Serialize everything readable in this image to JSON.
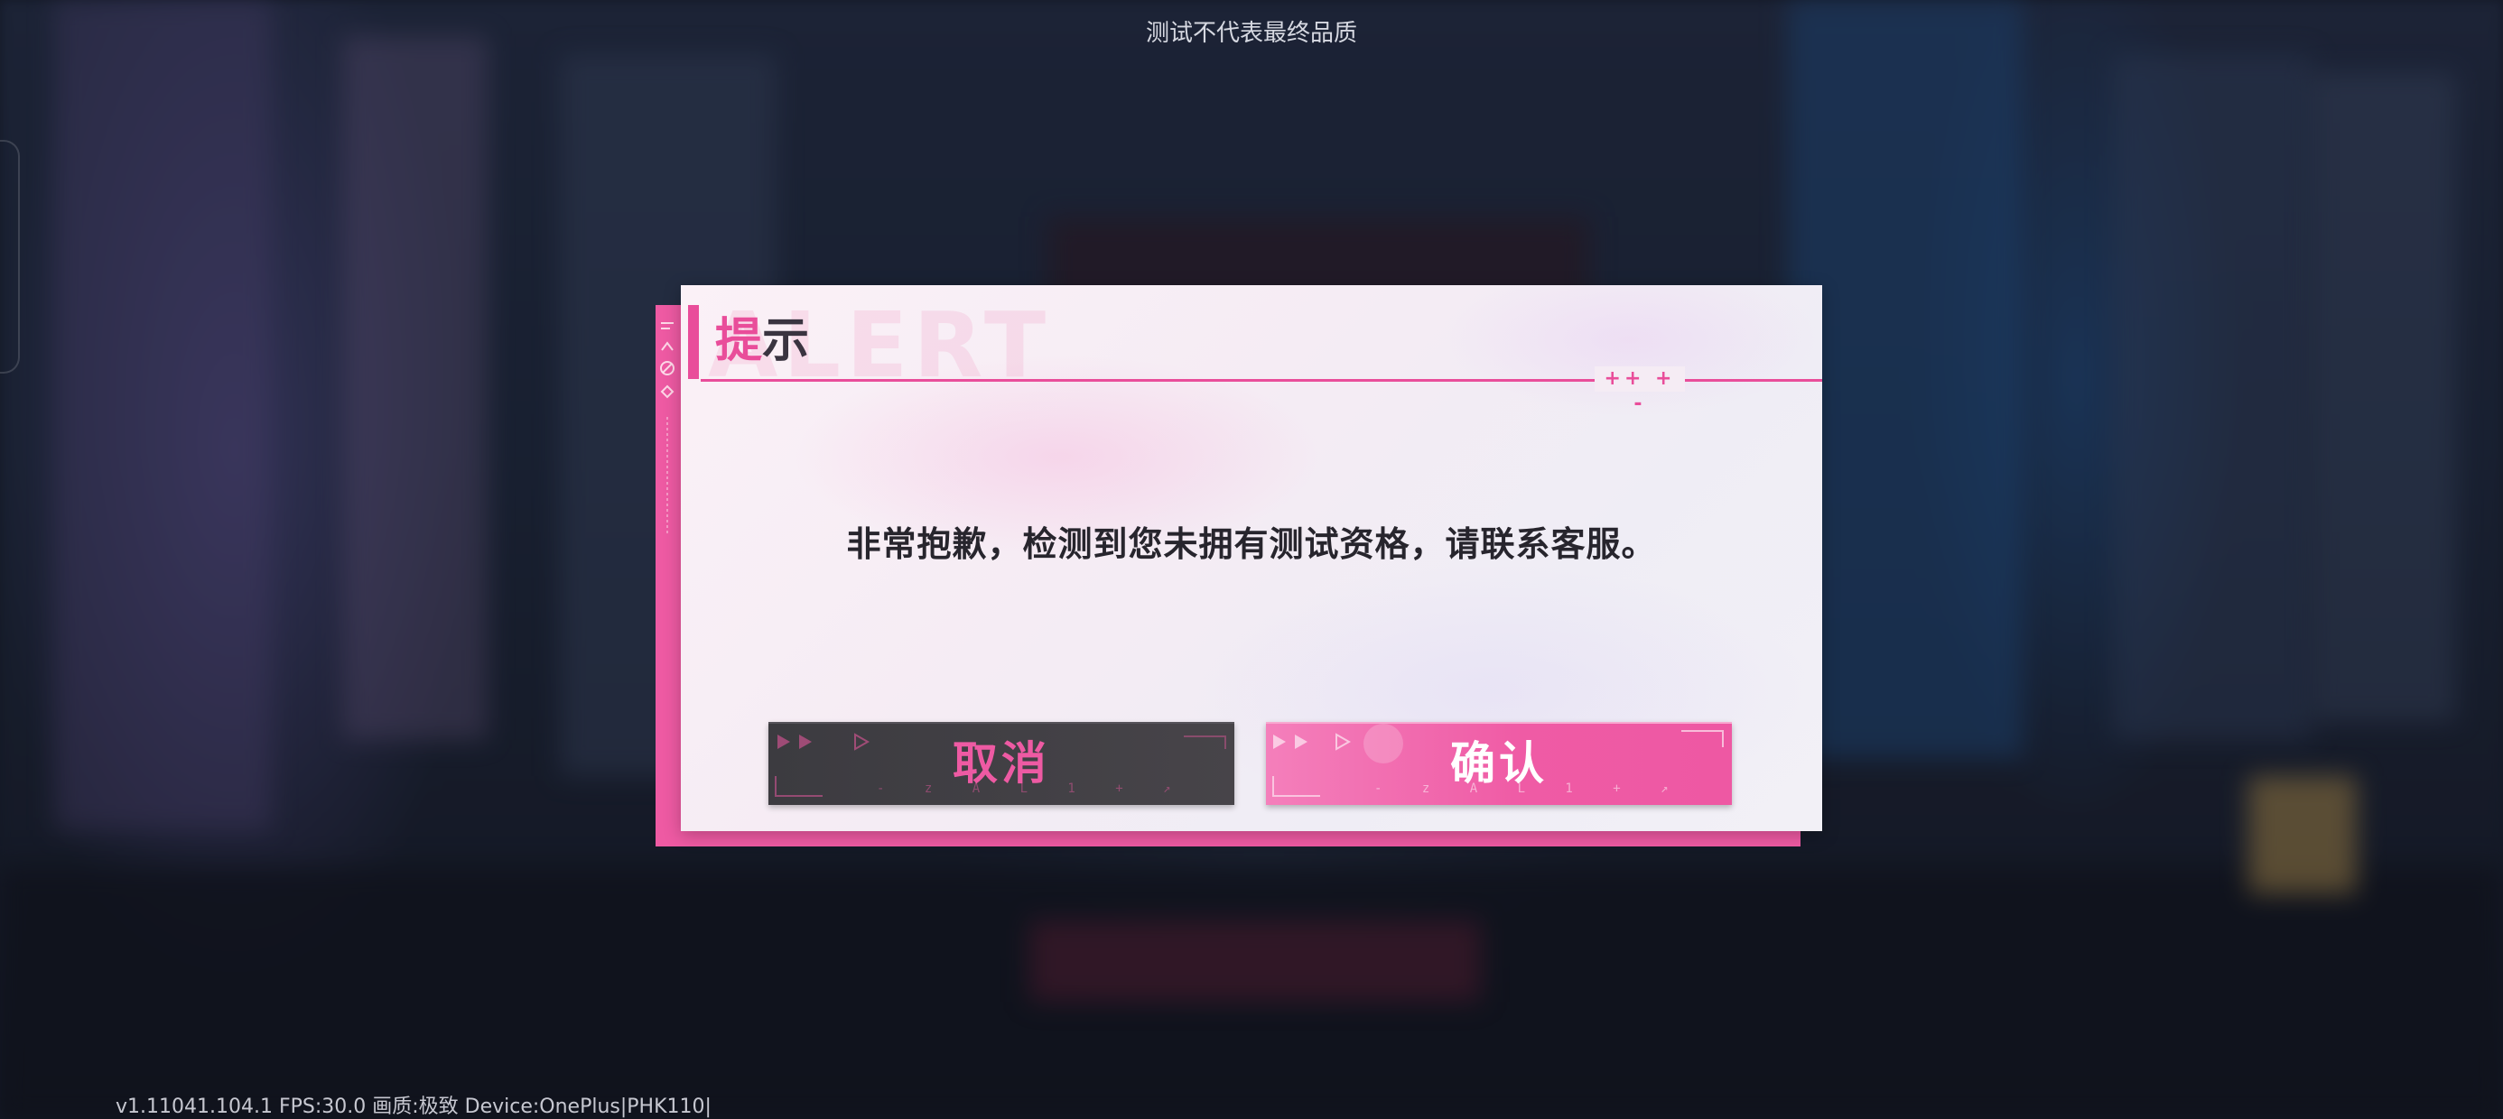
{
  "overlay": {
    "watermark": "测试不代表最终品质",
    "status_line": "v1.11041.104.1 FPS:30.0 画质:极致 Device:OnePlus|PHK110|"
  },
  "dialog": {
    "title_highlight": "提",
    "title_rest": "示",
    "message": "非常抱歉，检测到您未拥有测试资格，请联系客服。",
    "cancel_label": "取消",
    "confirm_label": "确认"
  },
  "colors": {
    "accent_pink": "#ee5aa3",
    "panel_bg": "#f5ecf4",
    "cancel_button_bg": "#3f3d42",
    "confirm_button_bg": "#ef5ba5",
    "message_text": "#27252d"
  },
  "icons": [
    "play-triangle-icon",
    "plus-sparkle-icon",
    "corner-bracket-icon"
  ]
}
